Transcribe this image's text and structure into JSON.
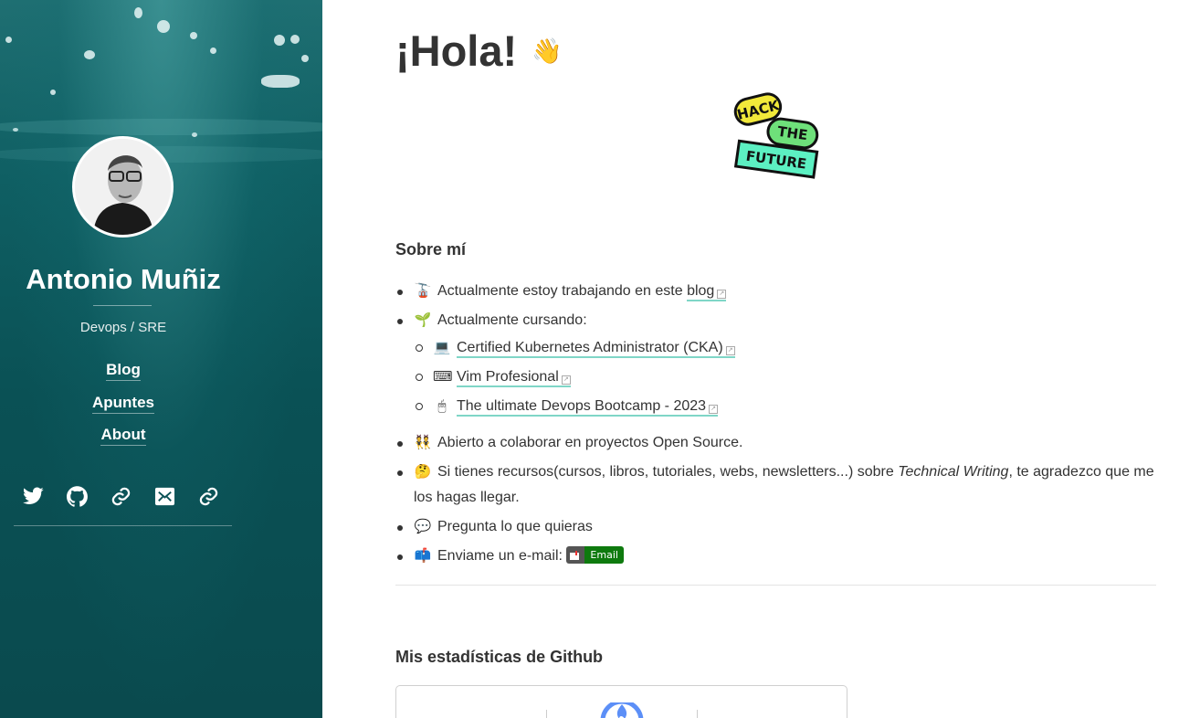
{
  "sidebar": {
    "author_name": "Antonio Muñiz",
    "author_role": "Devops / SRE",
    "nav": [
      {
        "label": "Blog"
      },
      {
        "label": "Apuntes"
      },
      {
        "label": "About"
      }
    ],
    "social_icons": [
      "twitter-icon",
      "github-icon",
      "link-icon",
      "email-icon",
      "link-icon"
    ],
    "colors": {
      "background": "#0a5155",
      "text": "#ffffff"
    }
  },
  "main": {
    "title": "¡Hola!",
    "title_emoji": "👋",
    "logo_text": [
      "HACK",
      "THE",
      "FUTURE"
    ],
    "about_title": "Sobre mí",
    "items": {
      "working": {
        "emoji": "🚡",
        "text": "Actualmente estoy trabajando en este",
        "link": "blog"
      },
      "studying": {
        "emoji": "🌱",
        "text": "Actualmente cursando:"
      },
      "courses": [
        {
          "emoji": "💻",
          "label": "Certified Kubernetes Administrator (CKA)"
        },
        {
          "emoji": "⌨",
          "label": "Vim Profesional"
        },
        {
          "emoji": "🖱",
          "label": "The ultimate Devops Bootcamp - 2023"
        }
      ],
      "opensource": {
        "emoji": "👯",
        "text": "Abierto a colaborar en proyectos Open Source."
      },
      "resources": {
        "emoji": "🤔",
        "text_before": "Si tienes recursos(cursos, libros, tutoriales, webs, newsletters...) sobre",
        "text_em": "Technical Writing",
        "text_after": ", te agradezco que me los hagas llegar."
      },
      "ask": {
        "emoji": "💬",
        "text": "Pregunta lo que quieras"
      },
      "email": {
        "emoji": "📫",
        "text": "Enviame un e-mail:",
        "badge": "Email"
      }
    },
    "stats_title": "Mis estadísticas de Github",
    "colors": {
      "link_underline": "#7fd6c7",
      "badge_green": "#0e7a0e"
    }
  }
}
